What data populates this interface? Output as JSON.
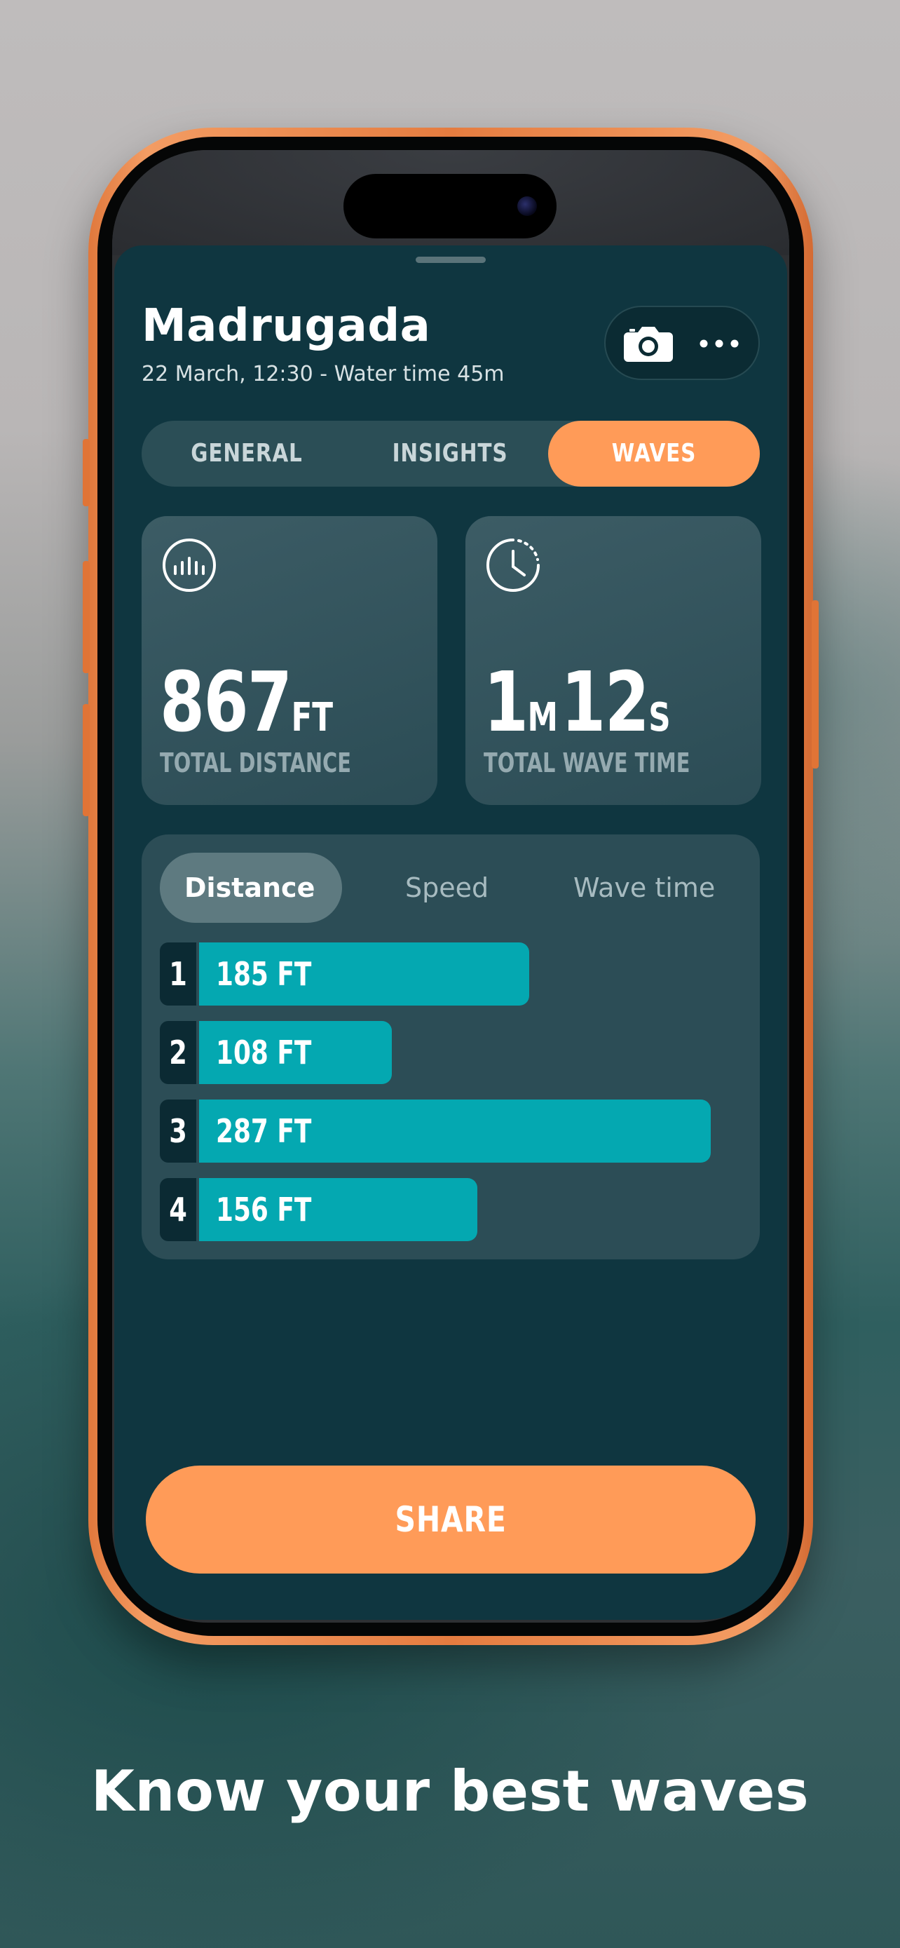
{
  "session": {
    "title": "Madrugada",
    "subtitle": "22 March, 12:30 - Water time 45m"
  },
  "actions": {
    "camera_icon": "camera-icon",
    "more_icon": "more-icon"
  },
  "tabs": [
    {
      "label": "GENERAL",
      "active": false
    },
    {
      "label": "INSIGHTS",
      "active": false
    },
    {
      "label": "WAVES",
      "active": true
    }
  ],
  "stats": {
    "distance": {
      "value": "867",
      "unit": "FT",
      "label": "TOTAL DISTANCE",
      "icon": "distance-gauge-icon"
    },
    "wave_time": {
      "min_value": "1",
      "min_unit": "M",
      "sec_value": "12",
      "sec_unit": "S",
      "label": "TOTAL WAVE TIME",
      "icon": "clock-icon"
    }
  },
  "segments": [
    {
      "label": "Distance",
      "active": true
    },
    {
      "label": "Speed",
      "active": false
    },
    {
      "label": "Wave time",
      "active": false
    }
  ],
  "waves": [
    {
      "index": "1",
      "label": "185 FT",
      "value": 185
    },
    {
      "index": "2",
      "label": "108 FT",
      "value": 108
    },
    {
      "index": "3",
      "label": "287 FT",
      "value": 287
    },
    {
      "index": "4",
      "label": "156 FT",
      "value": 156
    }
  ],
  "share_label": "SHARE",
  "tagline": "Know your best waves",
  "colors": {
    "accent": "#ff9b58",
    "bar": "#04a8b1",
    "sheet": "#0f3640",
    "phone_frame": "#e57c40"
  }
}
